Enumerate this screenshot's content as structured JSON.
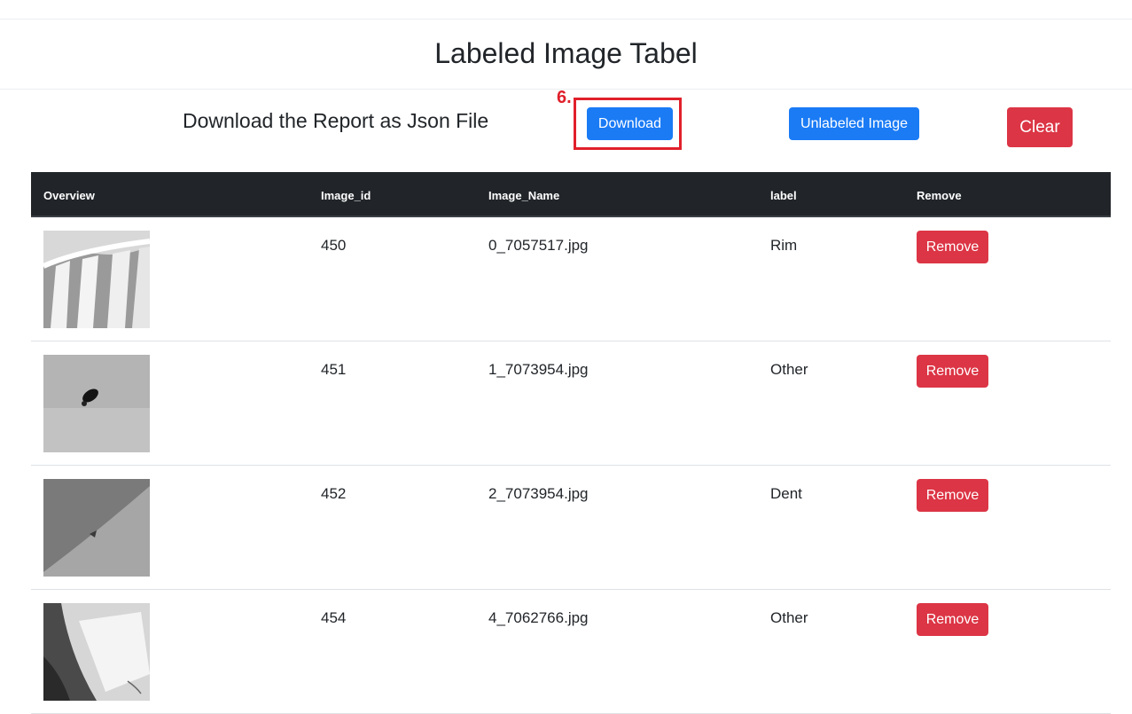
{
  "header": {
    "title": "Labeled Image Tabel"
  },
  "toolbar": {
    "report_text": "Download the Report as Json File",
    "annotation_label": "6.",
    "download_label": "Download",
    "unlabeled_label": "Unlabeled Image",
    "clear_label": "Clear"
  },
  "table": {
    "columns": [
      "Overview",
      "Image_id",
      "Image_Name",
      "label",
      "Remove"
    ],
    "rows": [
      {
        "image_id": "450",
        "image_name": "0_7057517.jpg",
        "label": "Rim",
        "remove_label": "Remove"
      },
      {
        "image_id": "451",
        "image_name": "1_7073954.jpg",
        "label": "Other",
        "remove_label": "Remove"
      },
      {
        "image_id": "452",
        "image_name": "2_7073954.jpg",
        "label": "Dent",
        "remove_label": "Remove"
      },
      {
        "image_id": "454",
        "image_name": "4_7062766.jpg",
        "label": "Other",
        "remove_label": "Remove"
      }
    ]
  },
  "colors": {
    "primary": "#1a7bf5",
    "danger": "#dc3545",
    "table_header": "#212529",
    "annotation": "#e0202b"
  }
}
